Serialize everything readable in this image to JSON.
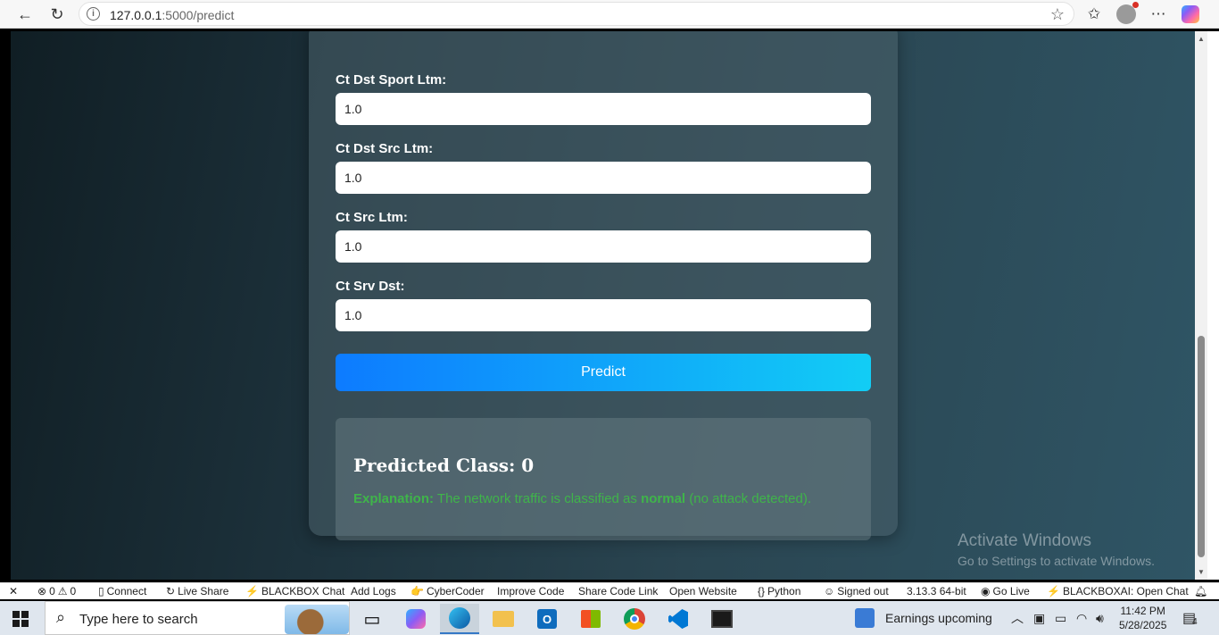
{
  "browser": {
    "url_host": "127.0.0.1",
    "url_path": ":5000/predict"
  },
  "form": {
    "fields": [
      {
        "label": "Ct Dst Sport Ltm:",
        "value": "1.0"
      },
      {
        "label": "Ct Dst Src Ltm:",
        "value": "1.0"
      },
      {
        "label": "Ct Src Ltm:",
        "value": "1.0"
      },
      {
        "label": "Ct Srv Dst:",
        "value": "1.0"
      }
    ],
    "predict_label": "Predict"
  },
  "result": {
    "title": "Predicted Class: 0",
    "explanation_label": "Explanation:",
    "explanation_text": "The network traffic is classified as",
    "explanation_strong": "normal",
    "explanation_tail": "(no attack detected)."
  },
  "watermark": {
    "line1": "Activate Windows",
    "line2": "Go to Settings to activate Windows."
  },
  "statusbar": {
    "problems": "0",
    "warnings": "0",
    "connect": "Connect",
    "live_share": "Live Share",
    "blackbox_chat": "BLACKBOX Chat",
    "add_logs": "Add Logs",
    "cybercoder": "CyberCoder",
    "improve_code": "Improve Code",
    "share_code_link": "Share Code Link",
    "open_website": "Open Website",
    "language": "Python",
    "signed_out": "Signed out",
    "python_version": "3.13.3 64-bit",
    "go_live": "Go Live",
    "blackboxai": "BLACKBOXAI: Open Chat"
  },
  "taskbar": {
    "search_placeholder": "Type here to search",
    "news": "Earnings upcoming",
    "time": "11:42 PM",
    "date": "5/28/2025",
    "notifications": "4"
  }
}
